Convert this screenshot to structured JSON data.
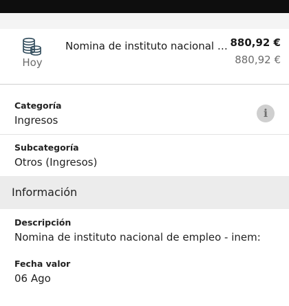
{
  "transaction": {
    "date": "Hoy",
    "title": "Nomina de instituto nacional de...",
    "amount": "880,92 €",
    "amount_secondary": "880,92 €",
    "icon": "coins-stack-icon"
  },
  "details": {
    "category_label": "Categoría",
    "category_value": "Ingresos",
    "subcategory_label": "Subcategoría",
    "subcategory_value": "Otros (Ingresos)",
    "info_icon": "i"
  },
  "section": {
    "title": "Información"
  },
  "info": {
    "description_label": "Descripción",
    "description_value": "Nomina de instituto nacional de empleo - inem:",
    "value_date_label": "Fecha valor",
    "value_date_value": "06 Ago"
  },
  "colors": {
    "status_bar": "#0e0e0e",
    "icon_stroke": "#2f4a5a",
    "section_bg": "#ececec",
    "info_badge": "#cfcfcf"
  }
}
